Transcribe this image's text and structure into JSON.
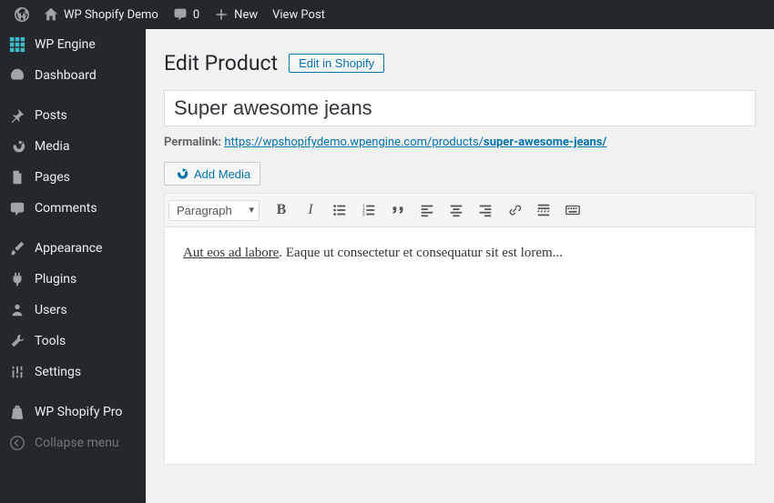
{
  "admin_bar": {
    "site_title": "WP Shopify Demo",
    "comment_count": "0",
    "new_label": "New",
    "view_post_label": "View Post"
  },
  "sidebar": {
    "items": [
      {
        "label": "WP Engine",
        "icon": "wpengine"
      },
      {
        "label": "Dashboard",
        "icon": "dashboard"
      },
      {
        "label": "Posts",
        "icon": "pin"
      },
      {
        "label": "Media",
        "icon": "media"
      },
      {
        "label": "Pages",
        "icon": "page"
      },
      {
        "label": "Comments",
        "icon": "comment"
      },
      {
        "label": "Appearance",
        "icon": "brush"
      },
      {
        "label": "Plugins",
        "icon": "plug"
      },
      {
        "label": "Users",
        "icon": "users"
      },
      {
        "label": "Tools",
        "icon": "tool"
      },
      {
        "label": "Settings",
        "icon": "settings"
      },
      {
        "label": "WP Shopify Pro",
        "icon": "shopify"
      }
    ],
    "collapse_label": "Collapse menu"
  },
  "page": {
    "heading": "Edit Product",
    "shopify_button": "Edit in Shopify",
    "title_value": "Super awesome jeans",
    "permalink_label": "Permalink:",
    "permalink_base": "https://wpshopifydemo.wpengine.com/products/",
    "permalink_slug": "super-awesome-jeans/",
    "add_media_label": "Add Media",
    "format_value": "Paragraph",
    "content_underlined": "Aut eos ad labore",
    "content_rest": ". Eaque ut consectetur et consequatur sit est lorem..."
  }
}
